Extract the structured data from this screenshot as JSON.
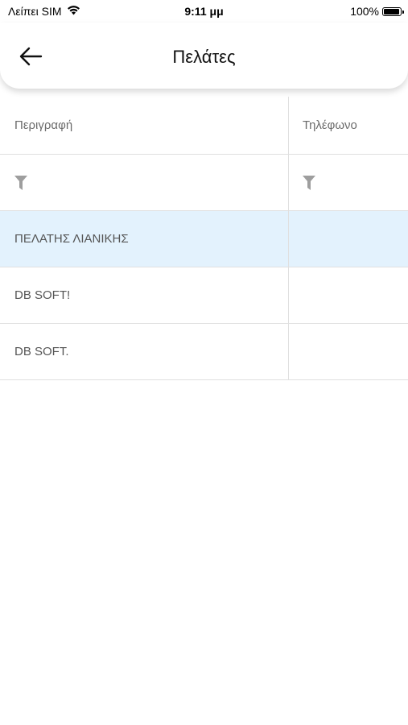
{
  "status_bar": {
    "carrier": "Λείπει SIM",
    "time": "9:11 μμ",
    "battery": "100%",
    "battery_level": 1.0
  },
  "header": {
    "title": "Πελάτες",
    "back_icon": "arrow-left-icon"
  },
  "table": {
    "columns": [
      "Περιγραφή",
      "Τηλέφωνο"
    ],
    "filter_icon": "filter-icon",
    "rows": [
      {
        "description": "ΠΕΛΑΤΗΣ ΛΙΑΝΙΚΗΣ",
        "phone": "",
        "selected": true
      },
      {
        "description": "DB SOFT!",
        "phone": "",
        "selected": false
      },
      {
        "description": "DB SOFT.",
        "phone": "",
        "selected": false
      }
    ],
    "selected_color": "#e3f2fd"
  }
}
